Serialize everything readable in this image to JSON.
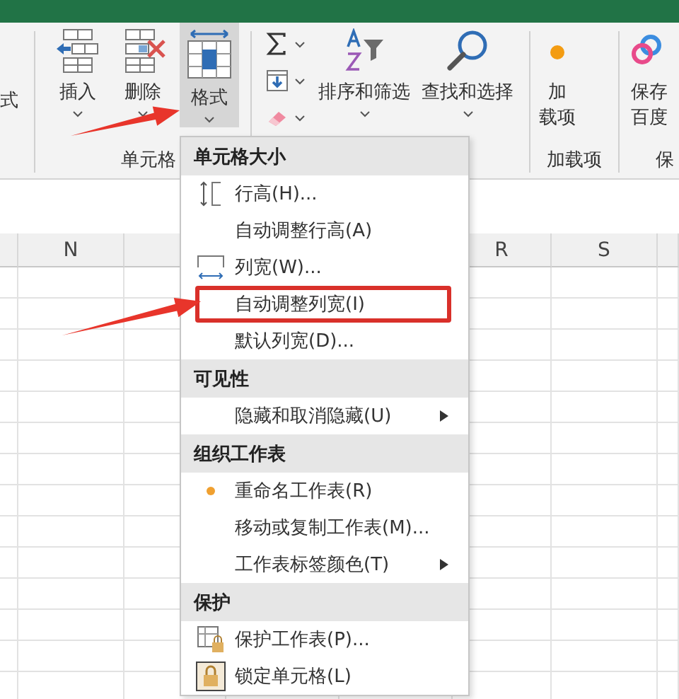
{
  "ribbon": {
    "cut_group_text": "式",
    "cells_group": {
      "label": "单元格",
      "buttons": [
        {
          "label": "插入",
          "selected": false
        },
        {
          "label": "删除",
          "selected": false
        },
        {
          "label": "格式",
          "selected": true
        }
      ]
    },
    "editing_group": {
      "buttons": [
        {
          "label": "排序和筛选"
        },
        {
          "label": "查找和选择"
        }
      ]
    },
    "addins_group": {
      "label": "加载项",
      "button_lines": [
        "加",
        "载项"
      ]
    },
    "cut_group": {
      "label": "保",
      "button_lines": [
        "保存",
        "百度"
      ]
    }
  },
  "column_headers": [
    "N",
    "R",
    "S"
  ],
  "menu": {
    "sections": [
      {
        "title": "单元格大小",
        "items": [
          {
            "label": "行高(H)...",
            "submenu": false,
            "highlighted": false
          },
          {
            "label": "自动调整行高(A)",
            "submenu": false,
            "highlighted": false
          },
          {
            "label": "列宽(W)...",
            "submenu": false,
            "highlighted": false
          },
          {
            "label": "自动调整列宽(I)",
            "submenu": false,
            "highlighted": true
          },
          {
            "label": "默认列宽(D)...",
            "submenu": false,
            "highlighted": false
          }
        ]
      },
      {
        "title": "可见性",
        "items": [
          {
            "label": "隐藏和取消隐藏(U)",
            "submenu": true,
            "highlighted": false
          }
        ]
      },
      {
        "title": "组织工作表",
        "items": [
          {
            "label": "重命名工作表(R)",
            "submenu": false,
            "highlighted": false
          },
          {
            "label": "移动或复制工作表(M)...",
            "submenu": false,
            "highlighted": false
          },
          {
            "label": "工作表标签颜色(T)",
            "submenu": true,
            "highlighted": false
          }
        ]
      },
      {
        "title": "保护",
        "items": [
          {
            "label": "保护工作表(P)...",
            "submenu": false,
            "highlighted": false
          },
          {
            "label": "锁定单元格(L)",
            "submenu": false,
            "highlighted": false
          }
        ]
      }
    ]
  },
  "annotations": [
    {
      "kind": "arrow"
    },
    {
      "kind": "arrow"
    }
  ]
}
